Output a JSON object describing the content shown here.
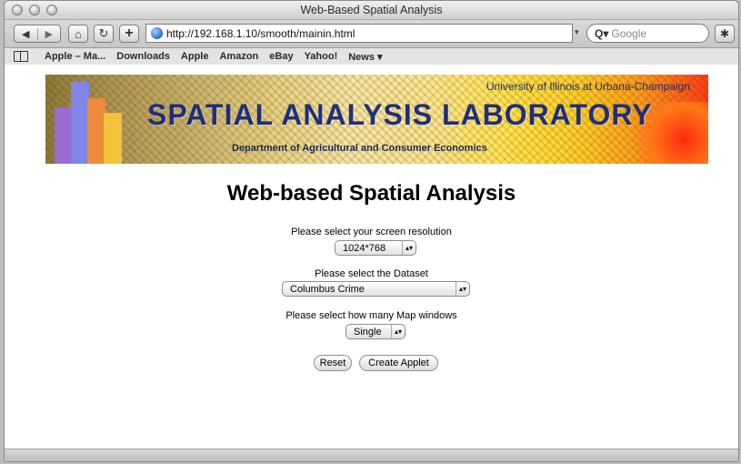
{
  "window": {
    "title": "Web-Based Spatial Analysis"
  },
  "toolbar": {
    "url": "http://192.168.1.10/smooth/mainin.html",
    "search_placeholder": "Google"
  },
  "bookmarks": [
    "Apple – Ma...",
    "Downloads",
    "Apple",
    "Amazon",
    "eBay",
    "Yahoo!",
    "News ▾"
  ],
  "banner": {
    "university": "University of Illinois at Urbana-Champaign",
    "lab": "SPATIAL ANALYSIS LABORATORY",
    "department": "Department of Agricultural and Consumer Economics"
  },
  "page": {
    "heading": "Web-based Spatial Analysis",
    "resolution_label": "Please select your screen resolution",
    "resolution_value": "1024*768",
    "dataset_label": "Please select the Dataset",
    "dataset_value": "Columbus Crime",
    "map_windows_label": "Please select how many Map windows",
    "map_windows_value": "Single",
    "reset_label": "Reset",
    "create_label": "Create Applet"
  }
}
